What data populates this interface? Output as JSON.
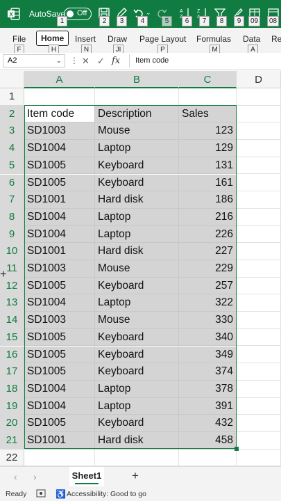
{
  "titlebar": {
    "autosave_label": "AutoSave",
    "autosave_state": "Off",
    "keytips": [
      "1",
      "2",
      "3",
      "4",
      "5",
      "6",
      "7",
      "8",
      "9",
      "09",
      "08"
    ]
  },
  "ribbon": {
    "tabs": [
      {
        "label": "File",
        "keytip": "F"
      },
      {
        "label": "Home",
        "keytip": "H"
      },
      {
        "label": "Insert",
        "keytip": "N"
      },
      {
        "label": "Draw",
        "keytip": "JI"
      },
      {
        "label": "Page Layout",
        "keytip": "P"
      },
      {
        "label": "Formulas",
        "keytip": "M"
      },
      {
        "label": "Data",
        "keytip": "A"
      },
      {
        "label": "Re",
        "keytip": ""
      }
    ],
    "active_tab": "Home"
  },
  "formula_bar": {
    "name_box": "A2",
    "content": "Item code",
    "fx": "fx"
  },
  "grid": {
    "columns": [
      "A",
      "B",
      "C",
      "D"
    ],
    "rows": [
      "1",
      "2",
      "3",
      "4",
      "5",
      "6",
      "7",
      "8",
      "9",
      "10",
      "11",
      "12",
      "13",
      "14",
      "15",
      "16",
      "17",
      "18",
      "19",
      "20",
      "21",
      "22"
    ],
    "header": [
      "Item code",
      "Description",
      "Sales"
    ],
    "data": [
      [
        "SD1003",
        "Mouse",
        "123"
      ],
      [
        "SD1004",
        "Laptop",
        "129"
      ],
      [
        "SD1005",
        "Keyboard",
        "131"
      ],
      [
        "SD1005",
        "Keyboard",
        "161"
      ],
      [
        "SD1001",
        "Hard disk",
        "186"
      ],
      [
        "SD1004",
        "Laptop",
        "216"
      ],
      [
        "SD1004",
        "Laptop",
        "226"
      ],
      [
        "SD1001",
        "Hard disk",
        "227"
      ],
      [
        "SD1003",
        "Mouse",
        "229"
      ],
      [
        "SD1005",
        "Keyboard",
        "257"
      ],
      [
        "SD1004",
        "Laptop",
        "322"
      ],
      [
        "SD1003",
        "Mouse",
        "330"
      ],
      [
        "SD1005",
        "Keyboard",
        "340"
      ],
      [
        "SD1005",
        "Keyboard",
        "349"
      ],
      [
        "SD1005",
        "Keyboard",
        "374"
      ],
      [
        "SD1004",
        "Laptop",
        "378"
      ],
      [
        "SD1004",
        "Laptop",
        "391"
      ],
      [
        "SD1005",
        "Keyboard",
        "432"
      ],
      [
        "SD1001",
        "Hard disk",
        "458"
      ]
    ]
  },
  "sheet_tabs": {
    "active": "Sheet1",
    "add_label": "+"
  },
  "status": {
    "ready": "Ready",
    "accessibility": "Accessibility: Good to go"
  },
  "colors": {
    "accent": "#107c41",
    "selection_fill": "#d4d4d4"
  }
}
